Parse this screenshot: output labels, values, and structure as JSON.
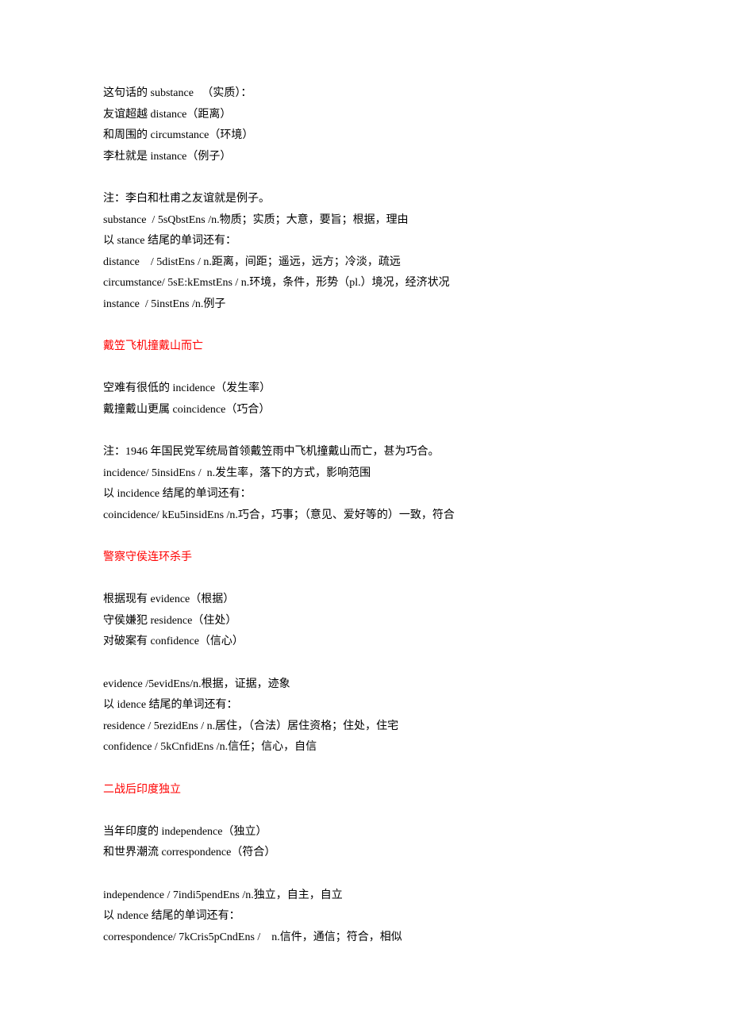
{
  "sections": [
    {
      "type": "block",
      "lines": [
        "这句话的 substance   （实质）：",
        "友谊超越 distance（距离）",
        "和周围的 circumstance（环境）",
        "李杜就是 instance（例子）"
      ]
    },
    {
      "type": "blank"
    },
    {
      "type": "block",
      "lines": [
        "注：李白和杜甫之友谊就是例子。",
        "substance  / 5sQbstEns /n.物质；实质；大意，要旨；根据，理由",
        "以 stance 结尾的单词还有：",
        "distance    / 5distEns / n.距离，间距；遥远，远方；冷淡，疏远",
        "circumstance/ 5sE:kEmstEns / n.环境，条件，形势（pl.）境况，经济状况",
        "instance  / 5instEns /n.例子"
      ]
    },
    {
      "type": "blank"
    },
    {
      "type": "heading",
      "text": "戴笠飞机撞戴山而亡"
    },
    {
      "type": "blank"
    },
    {
      "type": "block",
      "lines": [
        "空难有很低的 incidence（发生率）",
        "戴撞戴山更属 coincidence（巧合）"
      ]
    },
    {
      "type": "blank"
    },
    {
      "type": "block",
      "lines": [
        "注：1946 年国民党军统局首领戴笠雨中飞机撞戴山而亡，甚为巧合。",
        "incidence/ 5insidEns /  n.发生率，落下的方式，影响范围",
        "以 incidence 结尾的单词还有：",
        "coincidence/ kEu5insidEns /n.巧合，巧事；（意见、爱好等的）一致，符合"
      ]
    },
    {
      "type": "blank"
    },
    {
      "type": "heading",
      "text": "警察守侯连环杀手"
    },
    {
      "type": "blank"
    },
    {
      "type": "block",
      "lines": [
        "根据现有 evidence（根据）",
        "守侯嫌犯 residence（住处）",
        "对破案有 confidence（信心）"
      ]
    },
    {
      "type": "blank"
    },
    {
      "type": "block",
      "lines": [
        "evidence /5evidEns/n.根据，证据，迹象",
        "以 idence 结尾的单词还有：",
        "residence / 5rezidEns / n.居住，（合法）居住资格；住处，住宅",
        "confidence / 5kCnfidEns /n.信任；信心，自信"
      ]
    },
    {
      "type": "blank"
    },
    {
      "type": "heading",
      "text": "二战后印度独立"
    },
    {
      "type": "blank"
    },
    {
      "type": "block",
      "lines": [
        "当年印度的 independence（独立）",
        "和世界潮流 correspondence（符合）"
      ]
    },
    {
      "type": "blank"
    },
    {
      "type": "block",
      "lines": [
        "independence / 7indi5pendEns /n.独立，自主，自立",
        "以 ndence 结尾的单词还有：",
        "correspondence/ 7kCris5pCndEns /    n.信件，通信；符合，相似"
      ]
    }
  ]
}
